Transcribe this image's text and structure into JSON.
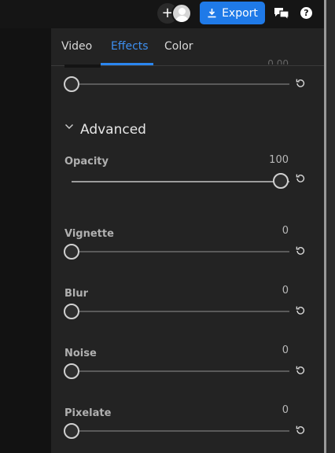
{
  "topbar": {
    "add_collaborator": "+",
    "export_label": "Export"
  },
  "tabs": [
    {
      "label": "Video",
      "active": false
    },
    {
      "label": "Effects",
      "active": true
    },
    {
      "label": "Color",
      "active": false
    }
  ],
  "section": {
    "title": "Advanced"
  },
  "sliders": [
    {
      "label": "",
      "value": "",
      "fraction": 0
    },
    {
      "label": "Opacity",
      "value": "100",
      "fraction": 1.0
    },
    {
      "label": "Vignette",
      "value": "0",
      "fraction": 0
    },
    {
      "label": "Blur",
      "value": "0",
      "fraction": 0
    },
    {
      "label": "Noise",
      "value": "0",
      "fraction": 0
    },
    {
      "label": "Pixelate",
      "value": "0",
      "fraction": 0
    }
  ],
  "colors": {
    "accent": "#1f7ae8",
    "active_tab": "#3d8ff0"
  },
  "icons": [
    "plus-icon",
    "avatar",
    "download-icon",
    "chat-icon",
    "help-icon",
    "chevron-down-icon",
    "reset-icon"
  ]
}
